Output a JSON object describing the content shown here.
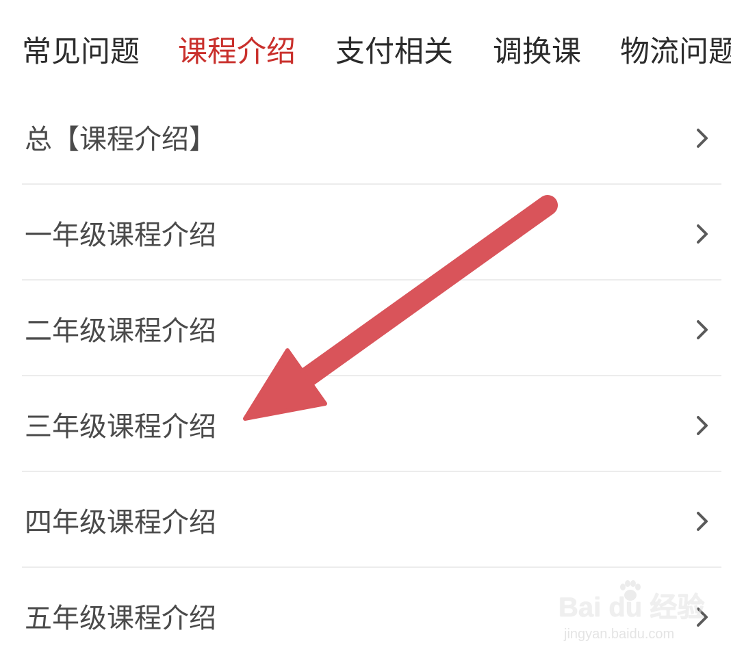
{
  "tabs": [
    {
      "label": "常见问题",
      "active": false
    },
    {
      "label": "课程介绍",
      "active": true
    },
    {
      "label": "支付相关",
      "active": false
    },
    {
      "label": "调换课",
      "active": false
    },
    {
      "label": "物流问题",
      "active": false
    }
  ],
  "list": {
    "items": [
      {
        "label": "总【课程介绍】"
      },
      {
        "label": "一年级课程介绍"
      },
      {
        "label": "二年级课程介绍"
      },
      {
        "label": "三年级课程介绍"
      },
      {
        "label": "四年级课程介绍"
      },
      {
        "label": "五年级课程介绍"
      }
    ]
  },
  "annotation": {
    "arrow_color": "#d9545a",
    "points_to": "三年级课程介绍"
  },
  "watermark": {
    "main": "Bai du 经验",
    "sub": "jingyan.baidu.com"
  },
  "colors": {
    "active_tab": "#c9302c",
    "tab_text": "#2b2b2b",
    "row_text": "#4a4a4a",
    "divider": "#ececec",
    "chevron": "#5a5a5a"
  }
}
